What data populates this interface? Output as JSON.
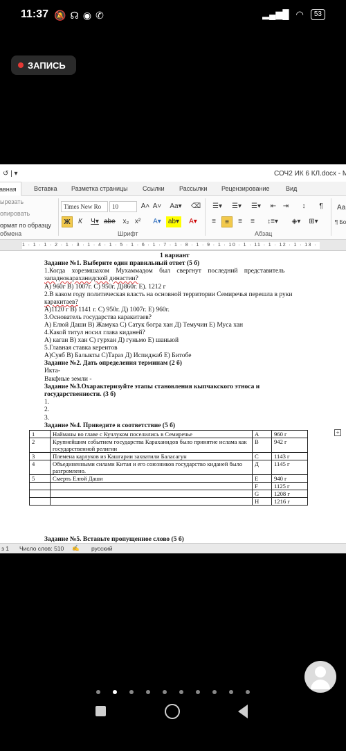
{
  "status": {
    "time": "11:37",
    "battery": "53"
  },
  "recording": {
    "label": "ЗАПИСЬ"
  },
  "word": {
    "doc_title": "СОЧ2 ИК 6 КЛ.docx  -  M",
    "tabs": [
      "авная",
      "Вставка",
      "Разметка страницы",
      "Ссылки",
      "Рассылки",
      "Рецензирование",
      "Вид"
    ],
    "clipboard": {
      "cut": "ырезать",
      "copy": "опировать",
      "format": "ормат по образцу",
      "label": "обмена"
    },
    "font": {
      "name": "Times New Ro",
      "size": "10",
      "label": "Шрифт"
    },
    "paragraph_label": "Абзац",
    "styles_sample": "Аа",
    "styles_sample2": "¶ Бо",
    "ruler": "1 · 1 · 1 · 2 · 1 · 3 · 1 · 4 · 1 · 5 · 1 · 6 · 1 · 7 · 1 · 8 · 1 · 9 · 1 · 10 · 1 · 11 · 1 · 12 · 1 · 13 ·",
    "statusbar": {
      "page": "з 1",
      "words": "Число слов: 510",
      "lang": "русский"
    }
  },
  "doc": {
    "variant": "1 вариант",
    "lines": [
      "Задание №1. Выберите один правильный ответ (5 б)",
      "1.Когда хорезмшахом Мухаммадом был свергнут последний представитель",
      "западнокараханидской династии?",
      "А) 960г В) 1007г. С) 950г. Д)860г. Е). 1212 г",
      "2.В каком году политическая власть на основной территории Семиречья перешла в руки",
      "каракитаев?",
      "А)1120 г В) 1141 г. С) 950г. Д) 1007г.  Е) 960г.",
      "3.Основатель государства каракитаев?",
      "А) Елюй Даши  В) Жамука  С) Сатук богра хан Д) Темучин  Е) Муса хан",
      "4.Какой титул носил глава киданей?",
      "А) каган В) хан С) гурхан Д) гуньмо Е) шаньюй",
      "5.Главная ставка кереитов",
      "А)Суяб  В) Балыкты  С)Тараз  Д) Испиджаб  Е) Битобе",
      "Задание №2. Дать определения терминам (2 б)",
      "Икта-",
      "Вакфные земли -",
      "Задание №3.Охарактеризуйте этапы становления кыпчакского этноса и",
      "государственности.  (3 б)",
      "1.",
      "2.",
      "3.",
      "Задание №4. Приведите в соответствие (5 б)"
    ],
    "table": [
      [
        "1",
        "Найманы во главе с Кучлуком поселились в Семиречье",
        "А",
        "960 г"
      ],
      [
        "2",
        "Крупнейшим событием государства Караханидов было принятие ислама как государственной религии",
        "В",
        "942 г"
      ],
      [
        "3",
        "Племена карлуков из Кашгарии захватили Баласагун",
        "С",
        "1143 г"
      ],
      [
        "4",
        "Объединенными силами Китая и его союзников государство киданей было разгромлено.",
        "Д",
        "1145 г"
      ],
      [
        "5",
        "Смерть Елюй Даши",
        "Е",
        "940 г"
      ],
      [
        "",
        "",
        "F",
        "1125 г"
      ],
      [
        "",
        "",
        "G",
        "1208 г"
      ],
      [
        "",
        "",
        "H",
        "1216 г"
      ]
    ],
    "task5": "Задание №5. Вставьте пропущенное слово (5 б)"
  }
}
